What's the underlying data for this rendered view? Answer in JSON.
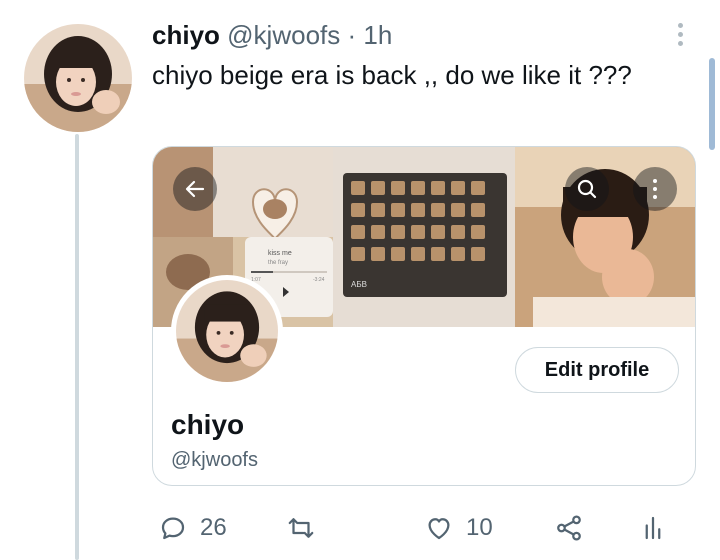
{
  "tweet": {
    "author_name": "chiyo",
    "author_handle": "@kjwoofs",
    "separator": "·",
    "time": "1h",
    "text": "chiyo beige era is back ,, do we like it ???"
  },
  "embedded_profile": {
    "name": "chiyo",
    "handle": "@kjwoofs",
    "edit_button_label": "Edit profile",
    "music_player": {
      "song": "kiss me",
      "artist": "the fray",
      "elapsed": "1:07",
      "remaining": "-3:24"
    },
    "keyboard_label": "АБВ"
  },
  "actions": {
    "reply_count": "26",
    "like_count": "10"
  },
  "icons": [
    "back-arrow-icon",
    "search-icon",
    "more-vertical-icon",
    "reply-icon",
    "retweet-icon",
    "like-icon",
    "share-icon",
    "analytics-icon"
  ],
  "colors": {
    "text": "#0f1419",
    "secondary": "#536471",
    "border": "#cfd9de",
    "banner_beige": "#d9c3a5"
  }
}
